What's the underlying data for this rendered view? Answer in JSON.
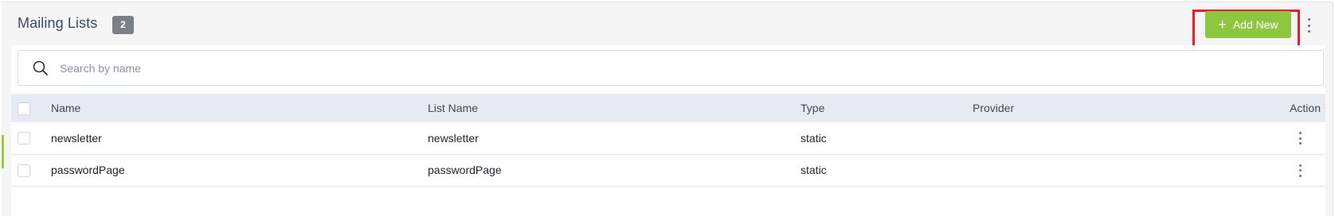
{
  "header": {
    "title": "Mailing Lists",
    "count": "2",
    "add_button_label": "Add New",
    "add_button_icon": "plus-icon",
    "menu_icon": "kebab-menu-icon"
  },
  "search": {
    "placeholder": "Search by name",
    "value": "",
    "icon": "search-icon"
  },
  "table": {
    "columns": [
      "Name",
      "List Name",
      "Type",
      "Provider",
      "Action"
    ],
    "rows": [
      {
        "name": "newsletter",
        "list_name": "newsletter",
        "type": "static",
        "provider": ""
      },
      {
        "name": "passwordPage",
        "list_name": "passwordPage",
        "type": "static",
        "provider": ""
      }
    ]
  },
  "colors": {
    "accent": "#8dc63f",
    "highlight": "#ea1c24",
    "header_row": "#e6eaf2",
    "badge": "#7b8088"
  }
}
